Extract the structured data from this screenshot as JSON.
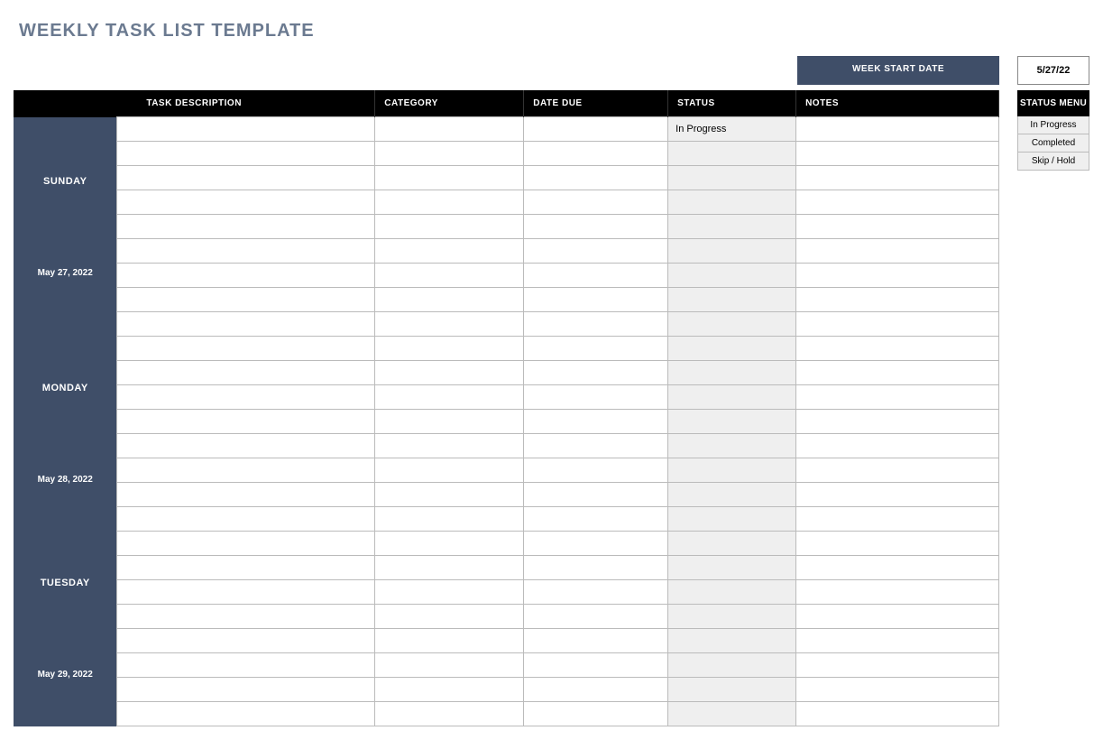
{
  "title": "WEEKLY TASK LIST TEMPLATE",
  "week_start": {
    "label": "WEEK START DATE",
    "value": "5/27/22"
  },
  "columns": {
    "task": "TASK DESCRIPTION",
    "category": "CATEGORY",
    "due": "DATE DUE",
    "status": "STATUS",
    "notes": "NOTES"
  },
  "status_menu": {
    "header": "STATUS MENU",
    "items": [
      "In Progress",
      "Completed",
      "Skip / Hold"
    ]
  },
  "days": [
    {
      "name": "SUNDAY",
      "date": "May 27, 2022",
      "rows": [
        {
          "task": "",
          "category": "",
          "due": "",
          "status": "In Progress",
          "notes": ""
        },
        {
          "task": "",
          "category": "",
          "due": "",
          "status": "",
          "notes": ""
        },
        {
          "task": "",
          "category": "",
          "due": "",
          "status": "",
          "notes": ""
        },
        {
          "task": "",
          "category": "",
          "due": "",
          "status": "",
          "notes": ""
        },
        {
          "task": "",
          "category": "",
          "due": "",
          "status": "",
          "notes": ""
        },
        {
          "task": "",
          "category": "",
          "due": "",
          "status": "",
          "notes": ""
        },
        {
          "task": "",
          "category": "",
          "due": "",
          "status": "",
          "notes": ""
        },
        {
          "task": "",
          "category": "",
          "due": "",
          "status": "",
          "notes": ""
        },
        {
          "task": "",
          "category": "",
          "due": "",
          "status": "",
          "notes": ""
        }
      ]
    },
    {
      "name": "MONDAY",
      "date": "May 28, 2022",
      "rows": [
        {
          "task": "",
          "category": "",
          "due": "",
          "status": "",
          "notes": ""
        },
        {
          "task": "",
          "category": "",
          "due": "",
          "status": "",
          "notes": ""
        },
        {
          "task": "",
          "category": "",
          "due": "",
          "status": "",
          "notes": ""
        },
        {
          "task": "",
          "category": "",
          "due": "",
          "status": "",
          "notes": ""
        },
        {
          "task": "",
          "category": "",
          "due": "",
          "status": "",
          "notes": ""
        },
        {
          "task": "",
          "category": "",
          "due": "",
          "status": "",
          "notes": ""
        },
        {
          "task": "",
          "category": "",
          "due": "",
          "status": "",
          "notes": ""
        },
        {
          "task": "",
          "category": "",
          "due": "",
          "status": "",
          "notes": ""
        }
      ]
    },
    {
      "name": "TUESDAY",
      "date": "May 29, 2022",
      "rows": [
        {
          "task": "",
          "category": "",
          "due": "",
          "status": "",
          "notes": ""
        },
        {
          "task": "",
          "category": "",
          "due": "",
          "status": "",
          "notes": ""
        },
        {
          "task": "",
          "category": "",
          "due": "",
          "status": "",
          "notes": ""
        },
        {
          "task": "",
          "category": "",
          "due": "",
          "status": "",
          "notes": ""
        },
        {
          "task": "",
          "category": "",
          "due": "",
          "status": "",
          "notes": ""
        },
        {
          "task": "",
          "category": "",
          "due": "",
          "status": "",
          "notes": ""
        },
        {
          "task": "",
          "category": "",
          "due": "",
          "status": "",
          "notes": ""
        },
        {
          "task": "",
          "category": "",
          "due": "",
          "status": "",
          "notes": ""
        }
      ]
    }
  ]
}
